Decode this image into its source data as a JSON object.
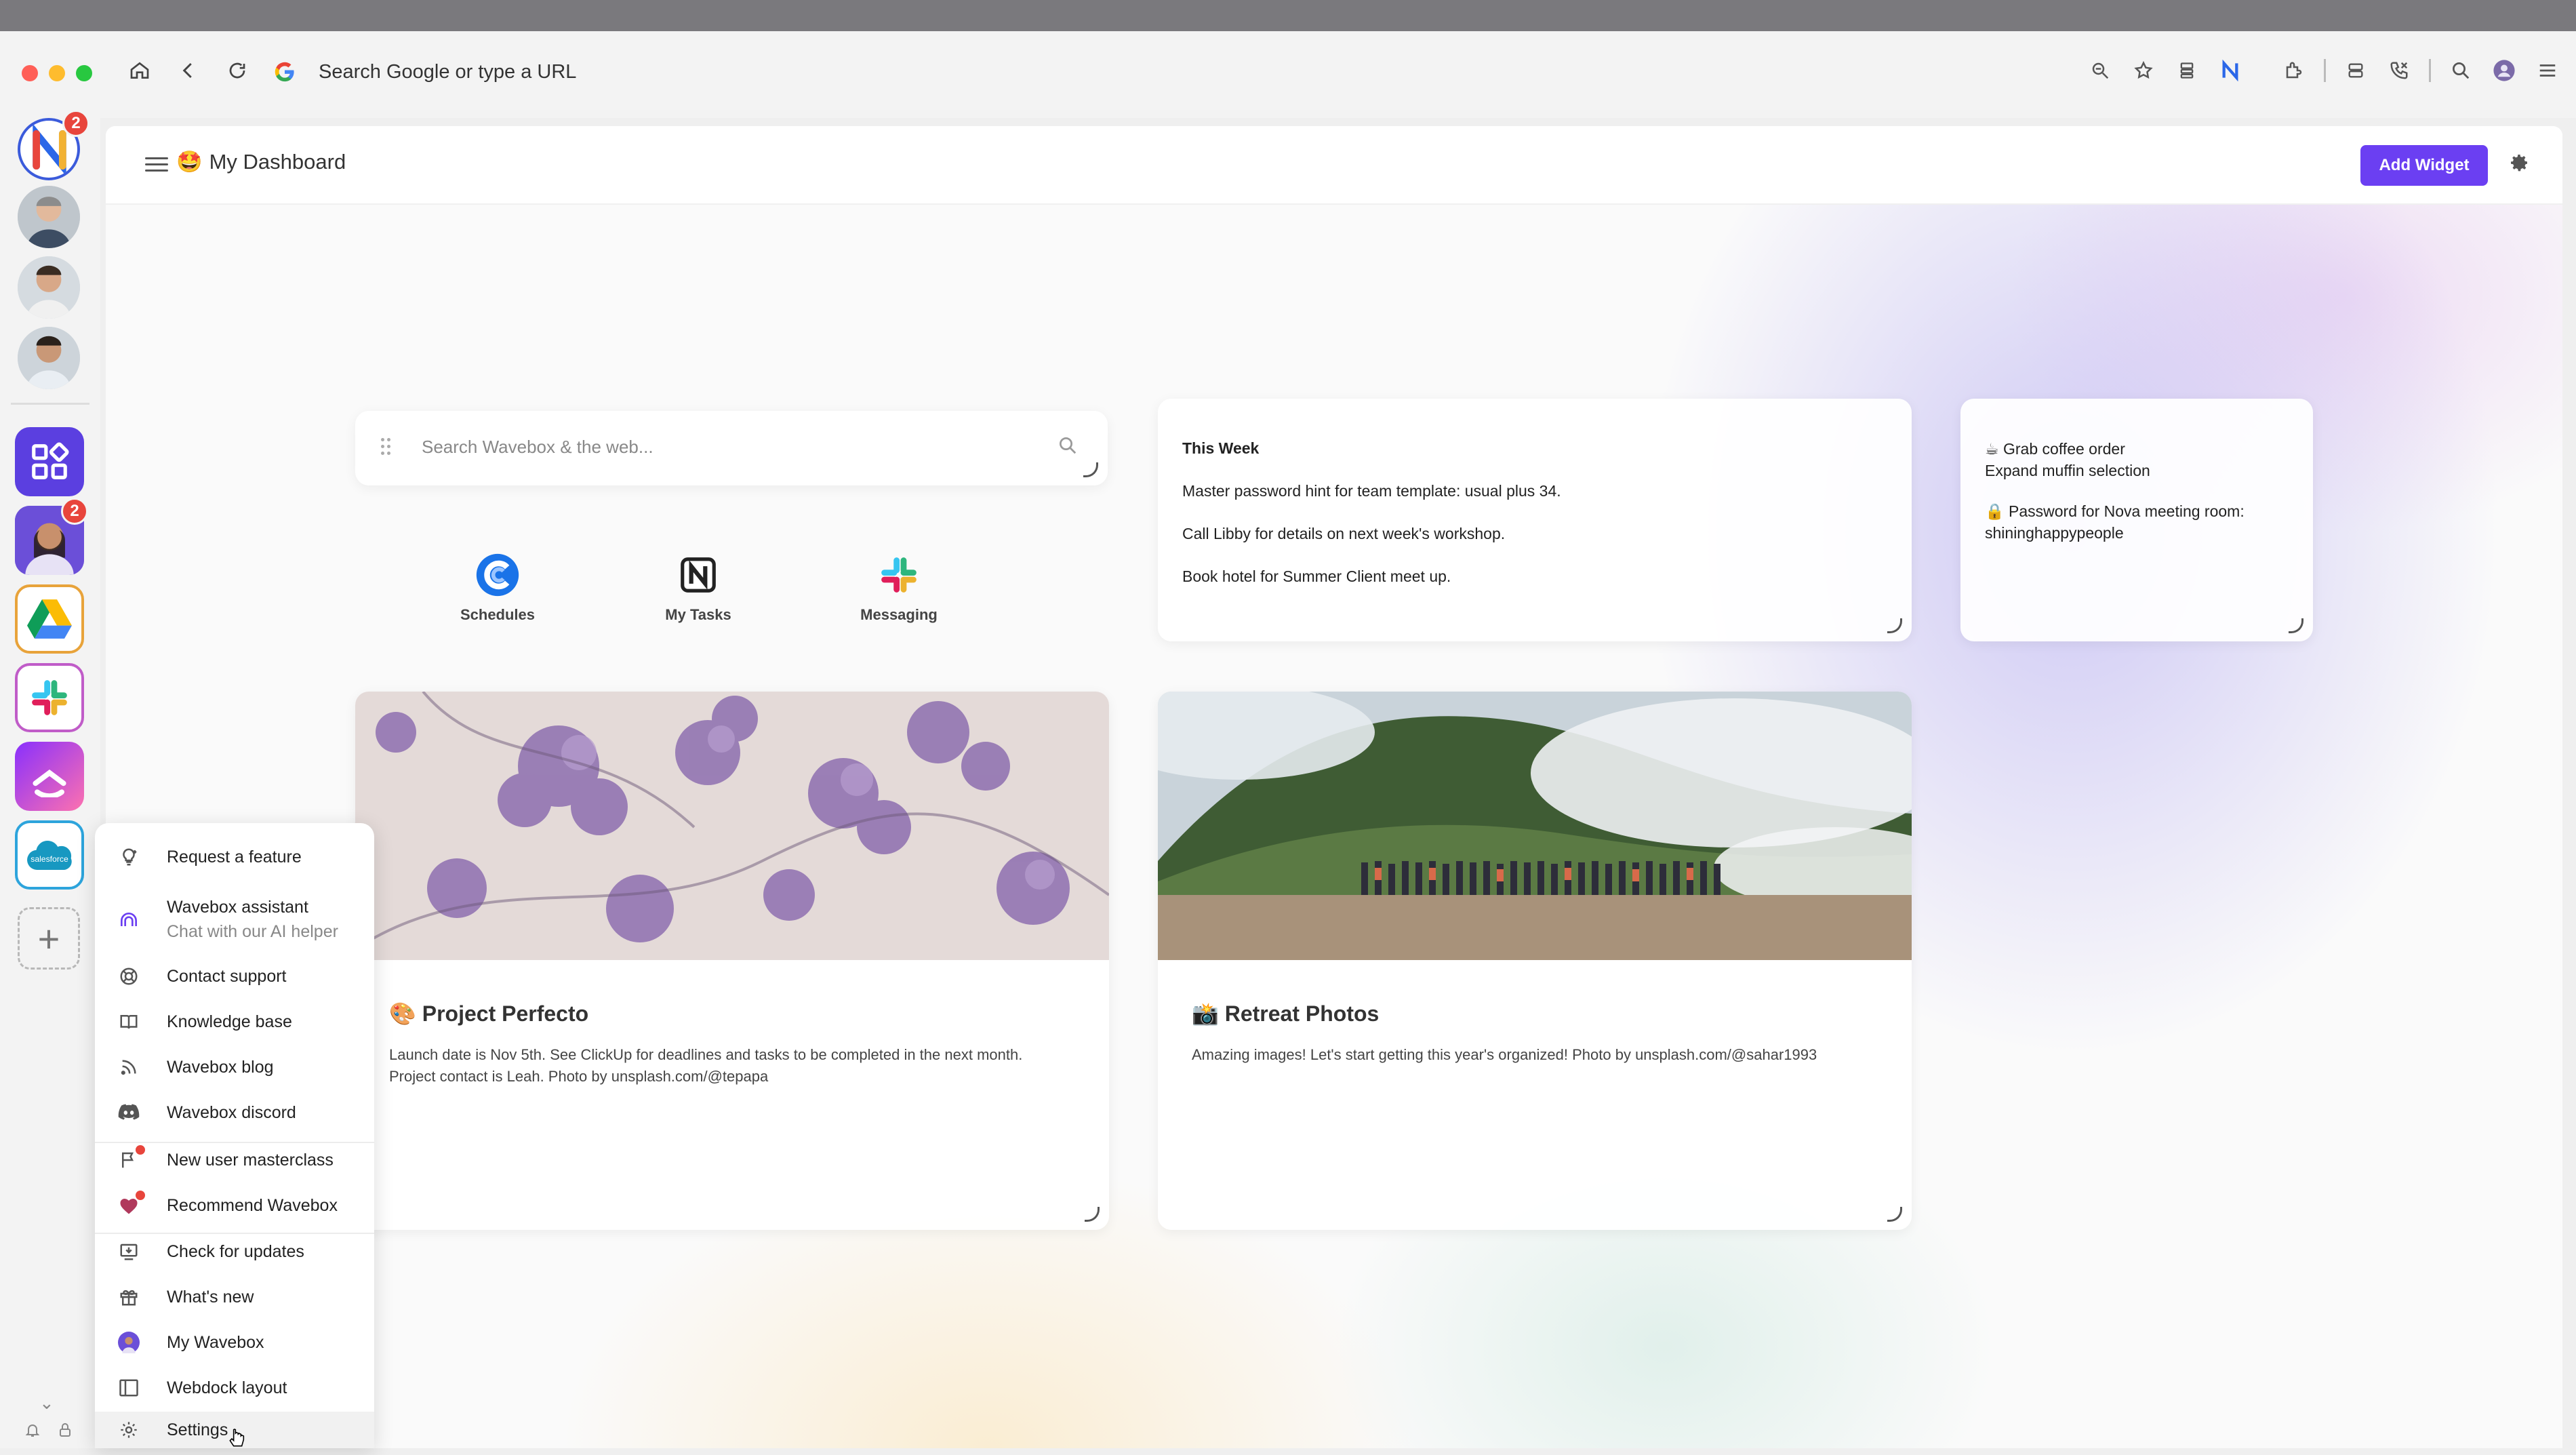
{
  "browser": {
    "address_placeholder": "Search Google or type a URL",
    "toolbar_icons": [
      "zoom-icon",
      "star-icon",
      "tab-list-icon",
      "wavebox-extension-icon",
      "extensions-icon",
      "database-icon",
      "phone-icon",
      "search-icon",
      "profile-icon",
      "menu-icon"
    ]
  },
  "dock": {
    "wavebox_badge": "2",
    "workspace_badge": "2",
    "apps": [
      "Wavebox",
      "Person 1",
      "Person 2",
      "Person 3",
      "Apps launcher",
      "Workspace",
      "Google Drive",
      "Slack",
      "ClickUp",
      "Salesforce"
    ],
    "add_label": "+",
    "salesforce_label": "salesforce"
  },
  "header": {
    "emoji": "🤩",
    "title": "My Dashboard",
    "add_widget": "Add Widget"
  },
  "search": {
    "placeholder": "Search Wavebox & the web..."
  },
  "shortcuts": [
    {
      "label": "Schedules"
    },
    {
      "label": "My Tasks"
    },
    {
      "label": "Messaging"
    }
  ],
  "this_week": {
    "title": "This Week",
    "lines": [
      "Master password hint for team template: usual plus 34.",
      "Call Libby for details on next week's workshop.",
      "Book hotel for Summer Client meet up."
    ]
  },
  "notes": {
    "line1": "☕ Grab coffee order",
    "line2": "Expand muffin selection",
    "line3": "🔒 Password for Nova meeting room:",
    "line4": "shininghappypeople"
  },
  "project": {
    "title": "🎨 Project Perfecto",
    "desc": "Launch date is Nov 5th. See ClickUp for deadlines and tasks to be completed in the next month. Project contact is Leah. Photo by unsplash.com/@tepapa"
  },
  "retreat": {
    "title": "📸 Retreat Photos",
    "desc": "Amazing images! Let's start getting this year's organized! Photo by unsplash.com/@sahar1993"
  },
  "menu": {
    "request_feature": "Request a feature",
    "assistant": "Wavebox assistant",
    "assistant_sub": "Chat with our AI helper",
    "contact_support": "Contact support",
    "knowledge_base": "Knowledge base",
    "blog": "Wavebox blog",
    "discord": "Wavebox discord",
    "masterclass": "New user masterclass",
    "recommend": "Recommend Wavebox",
    "check_updates": "Check for updates",
    "whats_new": "What's new",
    "my_wavebox": "My Wavebox",
    "webdock_layout": "Webdock layout",
    "settings": "Settings"
  },
  "colors": {
    "accent": "#6b3ff2",
    "badge": "#e8453c"
  }
}
